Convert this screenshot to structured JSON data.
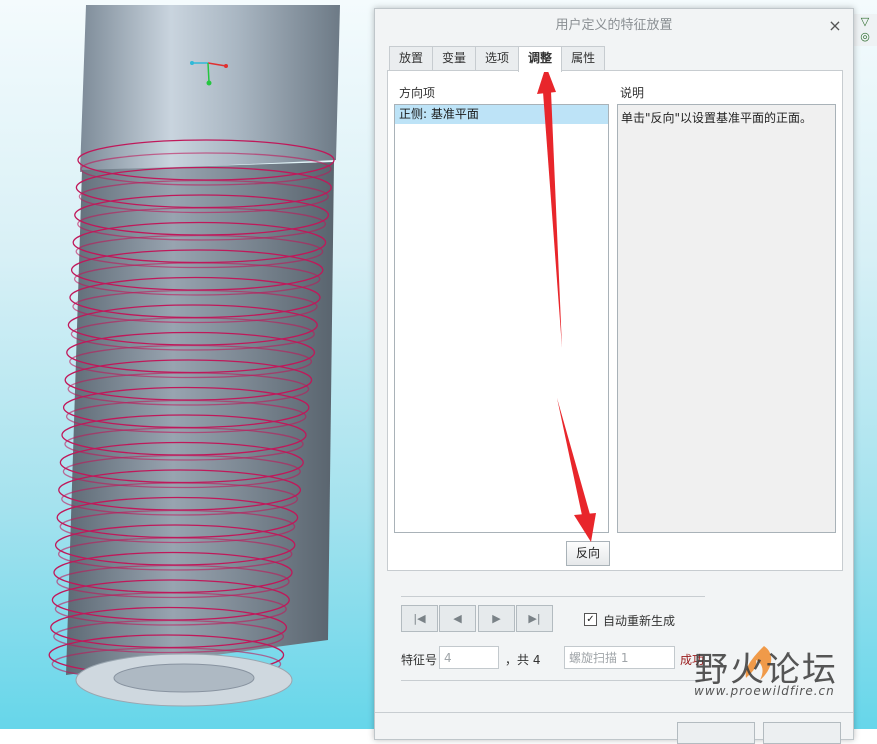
{
  "dialog": {
    "title": "用户定义的特征放置",
    "close_glyph": "×",
    "tabs": [
      {
        "label": "放置",
        "active": false
      },
      {
        "label": "变量",
        "active": false
      },
      {
        "label": "选项",
        "active": false
      },
      {
        "label": "调整",
        "active": true
      },
      {
        "label": "属性",
        "active": false
      }
    ],
    "direction_label": "方向项",
    "direction_items": [
      "正侧: 基准平面"
    ],
    "description_label": "说明",
    "description_text": "单击\"反向\"以设置基准平面的正面。",
    "flip_button": "反向",
    "navigation": {
      "first_glyph": "|◀",
      "prev_glyph": "◀",
      "next_glyph": "▶",
      "last_glyph": "▶|",
      "auto_regenerate_label": "自动重新生成",
      "auto_regenerate_checked": true,
      "feature_no_label": "特征号",
      "feature_no_value": "4",
      "total_label": "，共 4",
      "feature_name": "螺旋扫描 1",
      "status": "成功"
    }
  },
  "watermark": {
    "text_cn": "野火论坛",
    "url": "www.proewildfire.cn"
  },
  "colors": {
    "thread": "#c0185a",
    "annotation_arrow": "#e8262b",
    "status": "#9b1c1c",
    "selected_row": "#bde3f7"
  },
  "icons": [
    "close-icon",
    "first-record-icon",
    "prev-record-icon",
    "next-record-icon",
    "last-record-icon",
    "checkbox-icon",
    "coordinate-axis-icon",
    "flame-logo-icon"
  ]
}
